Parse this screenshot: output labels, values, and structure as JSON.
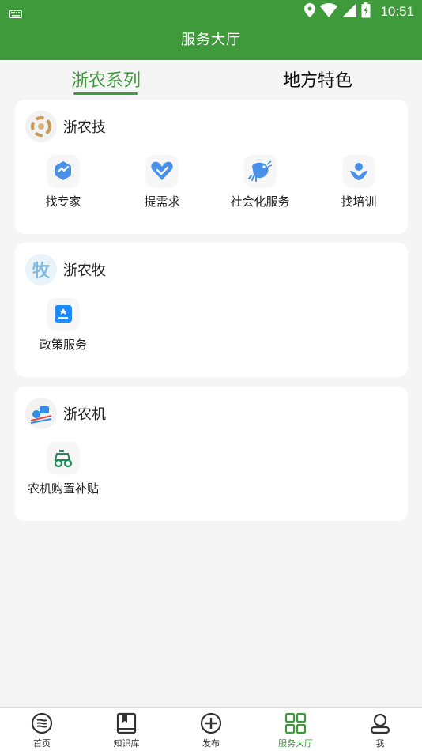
{
  "status_bar": {
    "time": "10:51"
  },
  "header": {
    "title": "服务大厅"
  },
  "tabs": [
    {
      "label": "浙农系列",
      "active": true
    },
    {
      "label": "地方特色",
      "active": false
    }
  ],
  "sections": [
    {
      "title": "浙农技",
      "logo": "zhenongji-logo",
      "items": [
        {
          "label": "找专家",
          "icon": "expert-icon"
        },
        {
          "label": "提需求",
          "icon": "heart-icon"
        },
        {
          "label": "社会化服务",
          "icon": "shrimp-icon"
        },
        {
          "label": "找培训",
          "icon": "training-icon"
        }
      ]
    },
    {
      "title": "浙农牧",
      "logo": "zhenongmu-logo",
      "logo_text": "牧",
      "items": [
        {
          "label": "政策服务",
          "icon": "policy-icon"
        }
      ]
    },
    {
      "title": "浙农机",
      "logo": "zhenongji-machine-logo",
      "items": [
        {
          "label": "农机购置补贴",
          "icon": "tractor-icon"
        }
      ]
    }
  ],
  "bottom_nav": [
    {
      "label": "首页",
      "icon": "home-icon",
      "active": false
    },
    {
      "label": "知识库",
      "icon": "book-icon",
      "active": false
    },
    {
      "label": "发布",
      "icon": "plus-circle-icon",
      "active": false
    },
    {
      "label": "服务大厅",
      "icon": "grid-icon",
      "active": true
    },
    {
      "label": "我",
      "icon": "user-icon",
      "active": false
    }
  ],
  "colors": {
    "brand_green": "#3f9a3c",
    "icon_blue": "#4a90e8",
    "icon_teal": "#1f8a5a"
  }
}
